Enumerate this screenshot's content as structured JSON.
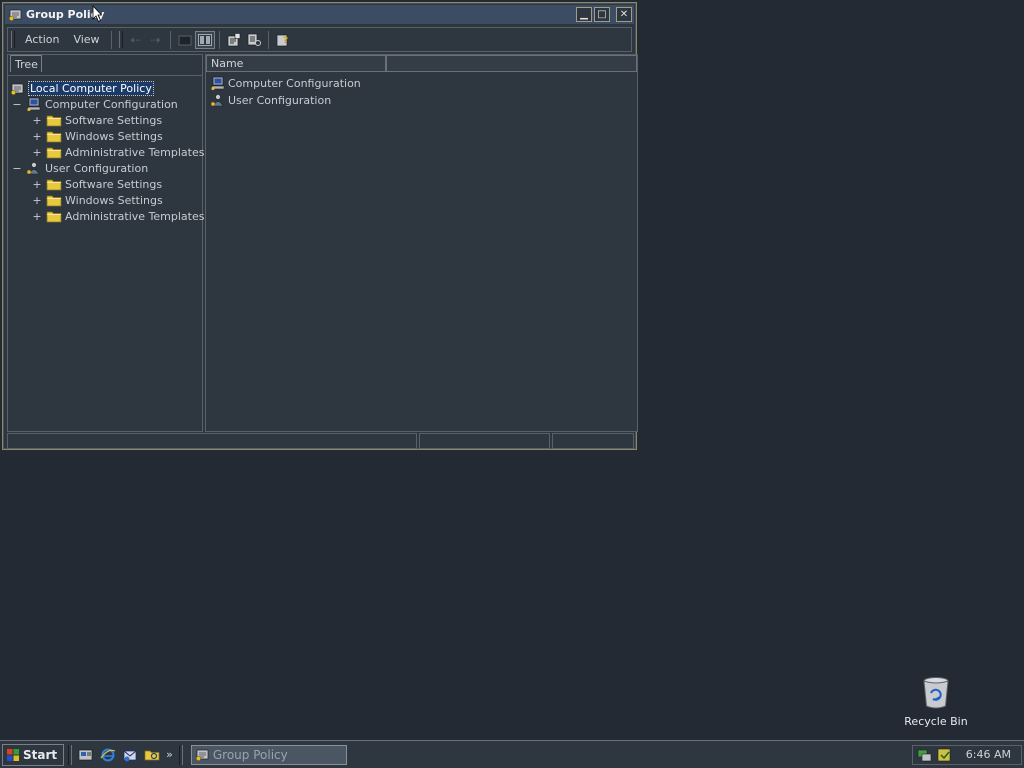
{
  "window": {
    "title": "Group Policy"
  },
  "menu": {
    "action": "Action",
    "view": "View"
  },
  "left_pane": {
    "tab_label": "Tree",
    "tree": [
      {
        "label": "Local Computer Policy",
        "level": 0,
        "icon": "policy-icon",
        "expander": "",
        "selected": true
      },
      {
        "label": "Computer Configuration",
        "level": 1,
        "icon": "computer-icon",
        "expander": "−"
      },
      {
        "label": "Software Settings",
        "level": 2,
        "icon": "folder-icon",
        "expander": "+"
      },
      {
        "label": "Windows Settings",
        "level": 2,
        "icon": "folder-icon",
        "expander": "+"
      },
      {
        "label": "Administrative Templates",
        "level": 2,
        "icon": "folder-icon",
        "expander": "+"
      },
      {
        "label": "User Configuration",
        "level": 1,
        "icon": "user-config-icon",
        "expander": "−"
      },
      {
        "label": "Software Settings",
        "level": 2,
        "icon": "folder-icon",
        "expander": "+"
      },
      {
        "label": "Windows Settings",
        "level": 2,
        "icon": "folder-icon",
        "expander": "+"
      },
      {
        "label": "Administrative Templates",
        "level": 2,
        "icon": "folder-icon",
        "expander": "+"
      }
    ]
  },
  "right_pane": {
    "column_header": "Name",
    "items": [
      {
        "label": "Computer Configuration",
        "icon": "computer-icon"
      },
      {
        "label": "User Configuration",
        "icon": "user-config-icon"
      }
    ]
  },
  "desktop": {
    "recycle_bin_label": "Recycle Bin"
  },
  "taskbar": {
    "start_label": "Start",
    "task_label": "Group Policy",
    "clock": "6:46 AM",
    "quick_launch_more": "»"
  },
  "colors": {
    "desktop": "#232a33",
    "titlebar": "#3c4d63",
    "selection": "#1a3a6a",
    "folder": "#e8c840"
  }
}
